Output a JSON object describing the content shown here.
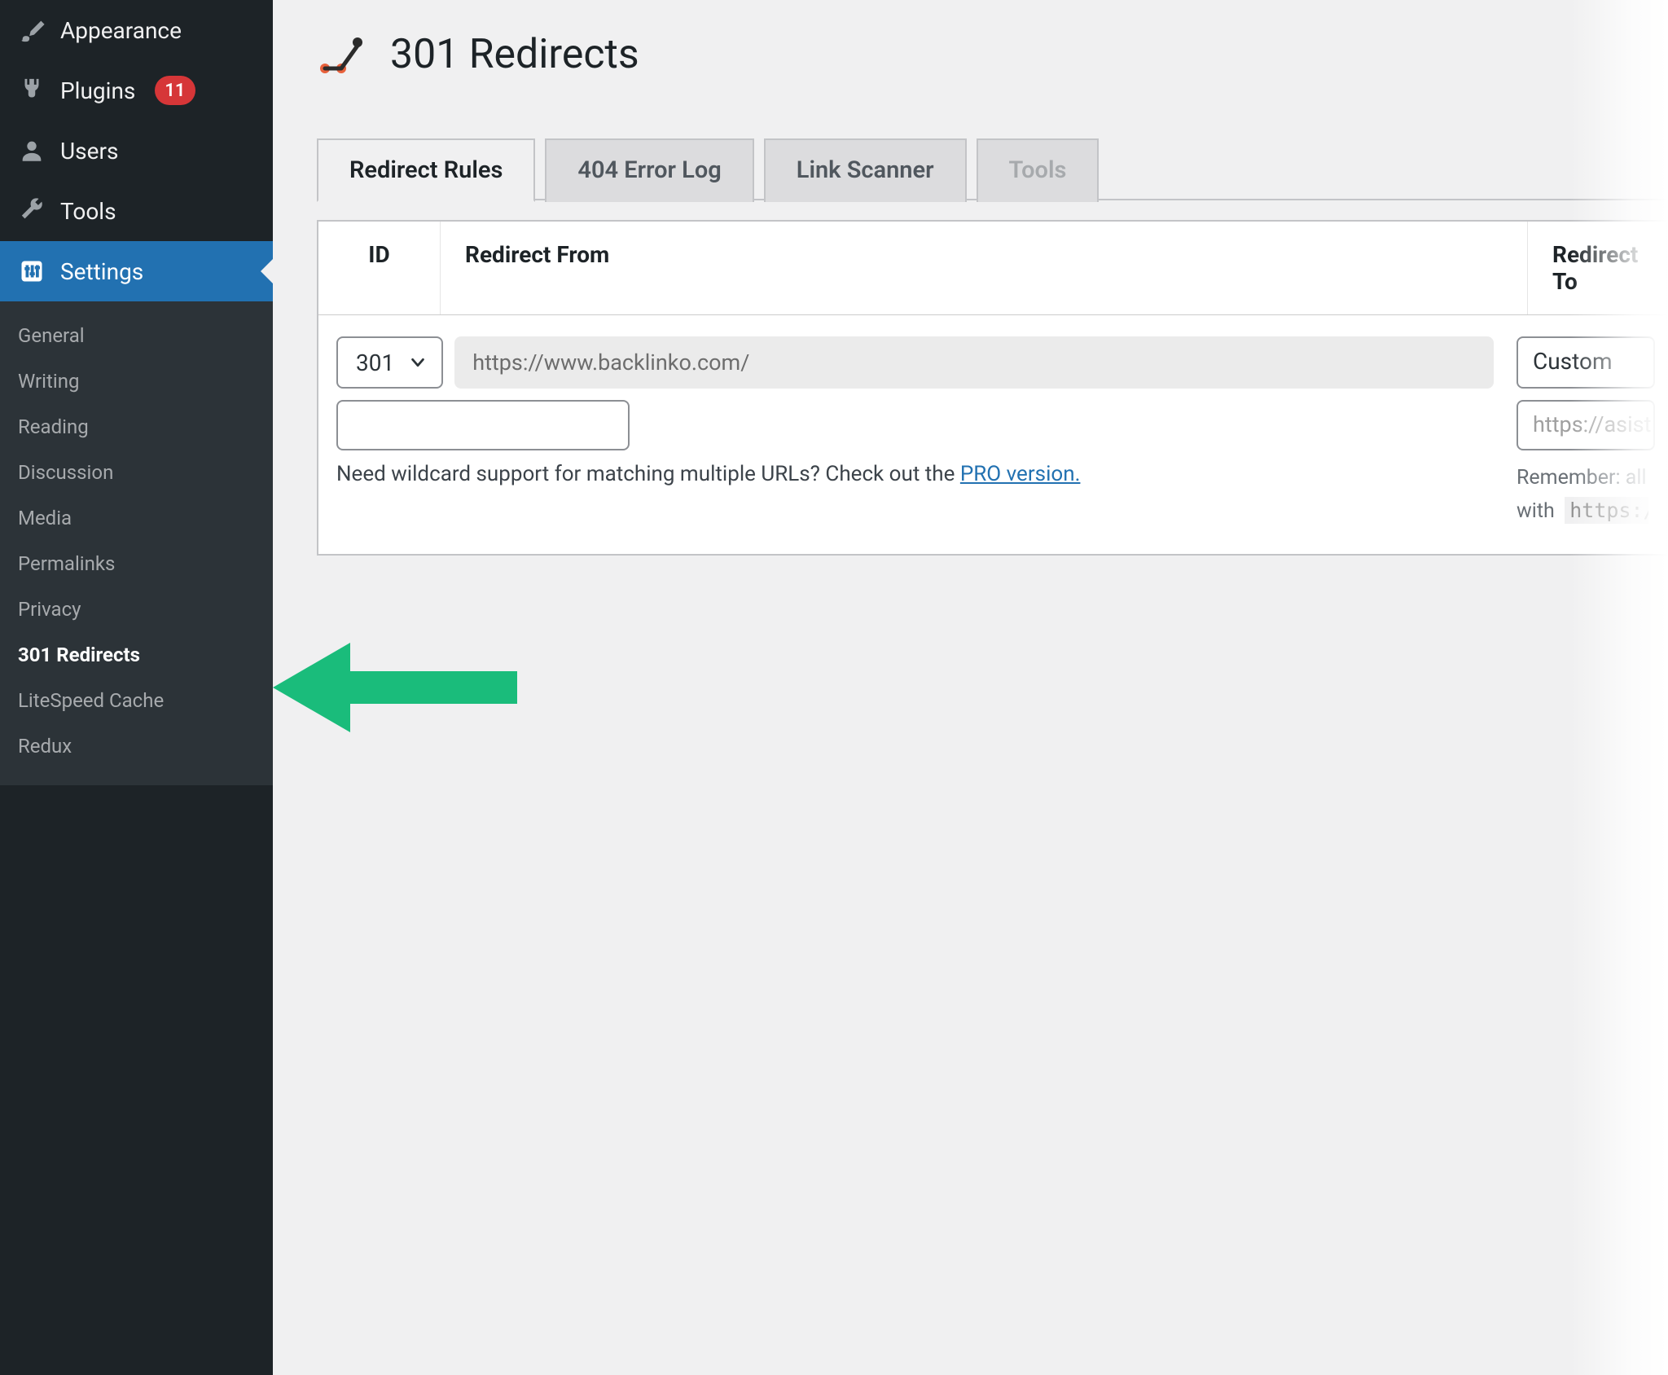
{
  "sidebar": {
    "items": [
      {
        "label": "Appearance",
        "icon": "brush"
      },
      {
        "label": "Plugins",
        "icon": "plug",
        "badge": "11"
      },
      {
        "label": "Users",
        "icon": "user"
      },
      {
        "label": "Tools",
        "icon": "wrench"
      },
      {
        "label": "Settings",
        "icon": "sliders",
        "active": true
      }
    ],
    "submenu": [
      {
        "label": "General"
      },
      {
        "label": "Writing"
      },
      {
        "label": "Reading"
      },
      {
        "label": "Discussion"
      },
      {
        "label": "Media"
      },
      {
        "label": "Permalinks"
      },
      {
        "label": "Privacy"
      },
      {
        "label": "301 Redirects",
        "current": true
      },
      {
        "label": "LiteSpeed Cache"
      },
      {
        "label": "Redux"
      }
    ]
  },
  "page": {
    "title": "301 Redirects"
  },
  "tabs": [
    {
      "label": "Redirect Rules",
      "active": true
    },
    {
      "label": "404 Error Log"
    },
    {
      "label": "Link Scanner"
    },
    {
      "label": "Tools",
      "disabled": true
    }
  ],
  "table": {
    "columns": {
      "id": "ID",
      "from": "Redirect From",
      "to": "Redirect To"
    },
    "row": {
      "type_value": "301",
      "from_url": "https://www.backlinko.com/",
      "from_input_value": "",
      "from_hint_pre": "Need wildcard support for matching multiple URLs? Check out the ",
      "from_hint_link": "PRO version.",
      "to_type": "Custom",
      "to_url_placeholder": "https://asist",
      "to_hint_pre": "Remember: all ext",
      "to_hint_mid": "with",
      "to_hint_code": "https://"
    }
  },
  "colors": {
    "accent": "#2271b1",
    "badge": "#d63638",
    "arrow": "#1abc7b",
    "logo_dot": "#e8613c"
  }
}
